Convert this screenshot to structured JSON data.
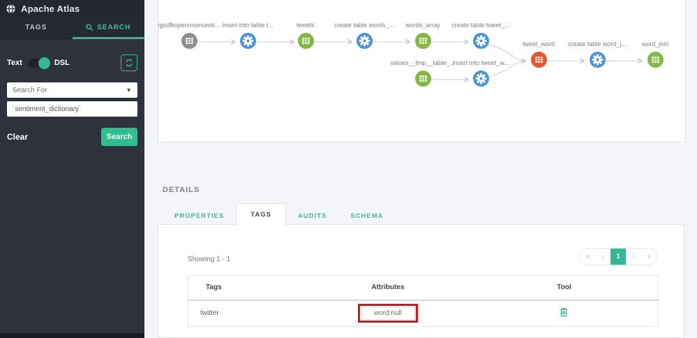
{
  "app": {
    "title": "Apache Atlas"
  },
  "colors": {
    "accent_teal": "#38b593",
    "node_process_blue": "#4a93dd",
    "node_table_green": "#85b744",
    "node_table_gray": "#8f8f8f",
    "node_current_orange": "#e2572e",
    "annotation_red": "#e31212",
    "sidebar_bg": "#2e323d",
    "page_bg": "#f4f5f9"
  },
  "sidebar": {
    "tabs": [
      {
        "label": "TAGS",
        "active": false
      },
      {
        "label": "SEARCH",
        "active": true
      }
    ],
    "mode_toggle": {
      "left": "Text",
      "right": "DSL",
      "state": "DSL"
    },
    "search_for": {
      "selected": "Search For"
    },
    "query": {
      "value": "`sentiment_dictionary`"
    },
    "clear_label": "Clear",
    "search_button_label": "Search"
  },
  "lineage": {
    "nodes": [
      {
        "label": "qjsdfkspenmsmuwst...",
        "type": "table-gray"
      },
      {
        "label": "insert into table t...",
        "type": "process"
      },
      {
        "label": "tweets",
        "type": "table-green"
      },
      {
        "label": "create table words_...",
        "type": "process"
      },
      {
        "label": "words_array",
        "type": "table-green"
      },
      {
        "label": "create table tweet_...",
        "type": "process"
      },
      {
        "label": "values__tmp__table_...",
        "type": "table-green"
      },
      {
        "label": "insert into tweet_w...",
        "type": "process"
      },
      {
        "label": "tweet_word",
        "type": "table-current"
      },
      {
        "label": "create table word_j...",
        "type": "process"
      },
      {
        "label": "word_join",
        "type": "table-green"
      }
    ]
  },
  "details": {
    "title": "DETAILS",
    "tabs": [
      {
        "label": "PROPERTIES",
        "active": false
      },
      {
        "label": "TAGS",
        "active": true
      },
      {
        "label": "AUDITS",
        "active": false
      },
      {
        "label": "SCHEMA",
        "active": false
      }
    ],
    "showing": "Showing 1 - 1",
    "pagination": {
      "first": "«",
      "prev": "‹",
      "page": "1",
      "next": "›",
      "last": "»"
    },
    "table": {
      "headers": [
        "Tags",
        "Attributes",
        "Tool"
      ],
      "rows": [
        {
          "tag": "twitter",
          "attributes": "word:null"
        }
      ]
    }
  }
}
